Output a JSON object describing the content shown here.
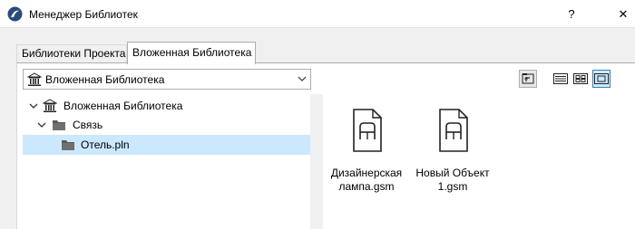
{
  "window": {
    "title": "Менеджер Библиотек",
    "help_label": "?",
    "close_label": "✕"
  },
  "tabs": [
    {
      "label": "Библиотеки Проекта",
      "active": false
    },
    {
      "label": "Вложенная Библиотека",
      "active": true
    }
  ],
  "library_dropdown": {
    "selected": "Вложенная Библиотека",
    "icon": "library-icon"
  },
  "view_toolbar": {
    "buttons": [
      {
        "icon": "folder-up-icon",
        "active": false
      },
      {
        "icon": "list-view-icon",
        "active": false
      },
      {
        "icon": "icon-grid-view-icon",
        "active": false
      },
      {
        "icon": "large-icon-view-icon",
        "active": true
      }
    ]
  },
  "tree": {
    "items": [
      {
        "label": "Вложенная Библиотека",
        "icon": "library-icon",
        "level": 0,
        "expanded": true,
        "selected": false
      },
      {
        "label": "Связь",
        "icon": "folder-icon",
        "level": 1,
        "expanded": true,
        "selected": false
      },
      {
        "label": "Отель.pln",
        "icon": "folder-icon",
        "level": 2,
        "expanded": false,
        "selected": true
      }
    ]
  },
  "files": {
    "items": [
      {
        "label_line1": "Дизайнерская",
        "label_line2": "лампа.gsm",
        "icon": "gsm-object-file-icon"
      },
      {
        "label_line1": "Новый Объект",
        "label_line2": "1.gsm",
        "icon": "gsm-object-file-icon"
      }
    ]
  },
  "colors": {
    "selection": "#cce8ff",
    "active_button": "#cde8ff",
    "active_button_border": "#3c7fb1"
  }
}
